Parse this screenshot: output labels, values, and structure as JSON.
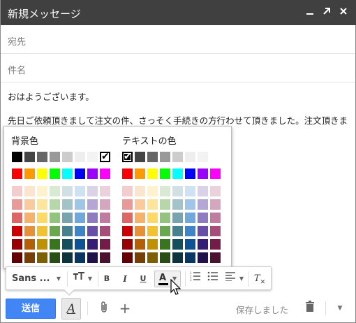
{
  "window": {
    "title": "新規メッセージ",
    "controls": [
      "minimize-icon",
      "popout-icon",
      "close-icon"
    ]
  },
  "fields": {
    "to_placeholder": "宛先",
    "subject_placeholder": "件名"
  },
  "message": {
    "line1": "おはようございます。",
    "line2": "先日ご依頼頂きまして注文の件、さっそく手続きの方行わせて頂きました。注文頂きました"
  },
  "color_picker": {
    "background_label": "背景色",
    "text_label": "テキストの色",
    "grays": [
      "#000000",
      "#444444",
      "#666666",
      "#999999",
      "#cccccc",
      "#eeeeee",
      "#f3f3f3",
      "#ffffff"
    ],
    "bright": [
      "#ff0000",
      "#ff9900",
      "#ffff00",
      "#00ff00",
      "#00ffff",
      "#0000ff",
      "#9900ff",
      "#ff00ff"
    ],
    "shades": [
      [
        "#f4cccc",
        "#fce5cd",
        "#fff2cc",
        "#d9ead3",
        "#d0e0e3",
        "#cfe2f3",
        "#d9d2e9",
        "#ead1dc"
      ],
      [
        "#ea9999",
        "#f9cb9c",
        "#ffe599",
        "#b6d7a8",
        "#a2c4c9",
        "#9fc5e8",
        "#b4a7d6",
        "#d5a6bd"
      ],
      [
        "#e06666",
        "#f6b26b",
        "#ffd966",
        "#93c47d",
        "#76a5af",
        "#6fa8dc",
        "#8e7cc3",
        "#c27ba0"
      ],
      [
        "#cc0000",
        "#e69138",
        "#f1c232",
        "#6aa84f",
        "#45818e",
        "#3d85c6",
        "#674ea7",
        "#a64d79"
      ],
      [
        "#990000",
        "#b45f06",
        "#bf9000",
        "#38761d",
        "#134f5c",
        "#0b5394",
        "#351c75",
        "#741b47"
      ],
      [
        "#660000",
        "#783f04",
        "#7f6000",
        "#274e13",
        "#0c343d",
        "#073763",
        "#20124d",
        "#4c1130"
      ]
    ],
    "background_selected": "#ffffff",
    "text_selected": "#000000"
  },
  "toolbar": {
    "font_label": "Sans ...",
    "size_icon": "text-size-icon",
    "bold_label": "B",
    "italic_label": "I",
    "underline_label": "U",
    "text_color_label": "A",
    "text_color_accent": "#000000",
    "numbered_list_icon": "numbered-list-icon",
    "bulleted_list_icon": "bulleted-list-icon",
    "align_icon": "align-icon",
    "clear_format_label": "T"
  },
  "bottom": {
    "send_label": "送信",
    "format_toggle_label": "A",
    "saved_label": "保存しました",
    "send_color": "#4285f4"
  }
}
